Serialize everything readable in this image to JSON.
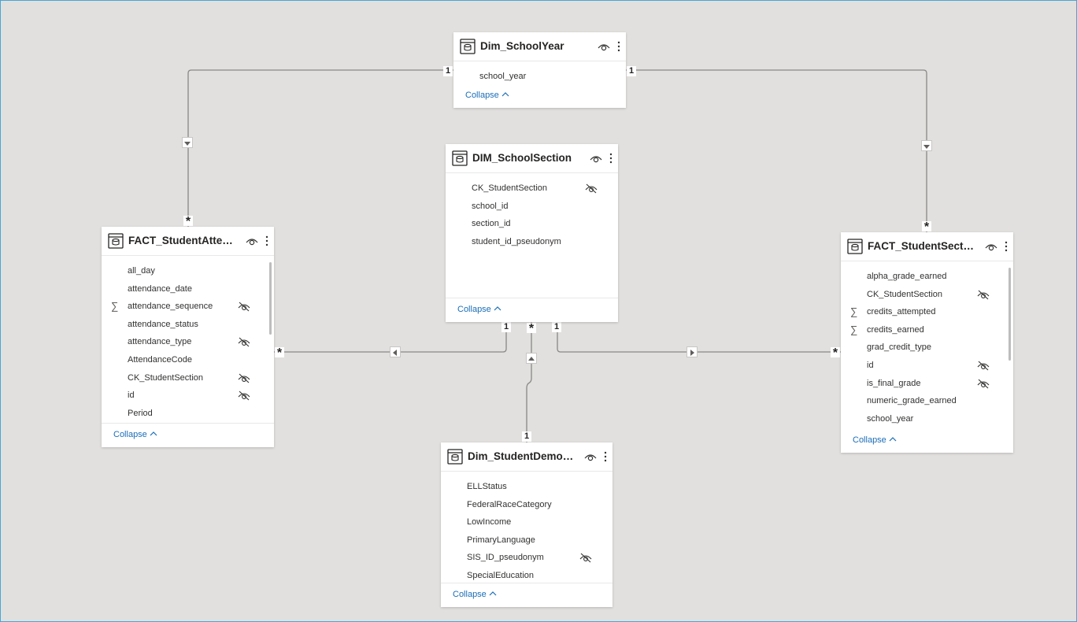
{
  "tables": {
    "school_year": {
      "title": "Dim_SchoolYear",
      "fields": [
        {
          "name": "school_year"
        }
      ],
      "collapse_label": "Collapse"
    },
    "school_section": {
      "title": "DIM_SchoolSection",
      "fields": [
        {
          "name": "CK_StudentSection",
          "hidden": true
        },
        {
          "name": "school_id"
        },
        {
          "name": "section_id"
        },
        {
          "name": "student_id_pseudonym"
        }
      ],
      "collapse_label": "Collapse"
    },
    "attendance": {
      "title": "FACT_StudentAttenda...",
      "fields": [
        {
          "name": "all_day"
        },
        {
          "name": "attendance_date"
        },
        {
          "name": "attendance_sequence",
          "sum": true,
          "hidden": true
        },
        {
          "name": "attendance_status"
        },
        {
          "name": "attendance_type",
          "hidden": true
        },
        {
          "name": "AttendanceCode"
        },
        {
          "name": "CK_StudentSection",
          "hidden": true
        },
        {
          "name": "id",
          "hidden": true
        },
        {
          "name": "Period"
        }
      ],
      "collapse_label": "Collapse"
    },
    "section_grades": {
      "title": "FACT_StudentSection...",
      "fields": [
        {
          "name": "alpha_grade_earned"
        },
        {
          "name": "CK_StudentSection",
          "hidden": true
        },
        {
          "name": "credits_attempted",
          "sum": true
        },
        {
          "name": "credits_earned",
          "sum": true
        },
        {
          "name": "grad_credit_type"
        },
        {
          "name": "id",
          "hidden": true
        },
        {
          "name": "is_final_grade",
          "hidden": true
        },
        {
          "name": "numeric_grade_earned"
        },
        {
          "name": "school_year"
        }
      ],
      "collapse_label": "Collapse"
    },
    "demographics": {
      "title": "Dim_StudentDemogr...",
      "fields": [
        {
          "name": "ELLStatus"
        },
        {
          "name": "FederalRaceCategory"
        },
        {
          "name": "LowIncome"
        },
        {
          "name": "PrimaryLanguage"
        },
        {
          "name": "SIS_ID_pseudonym",
          "hidden": true
        },
        {
          "name": "SpecialEducation"
        }
      ],
      "collapse_label": "Collapse"
    }
  },
  "cardinality": {
    "one": "1",
    "many": "*"
  },
  "icons": {
    "table": "table-icon",
    "visible": "eye-icon",
    "more": "more-options-icon",
    "hidden": "eye-hidden-icon",
    "sum": "sigma-icon",
    "collapse": "chevron-up-icon",
    "filter_direction": "triangle-arrow-icon"
  },
  "colors": {
    "canvas": "#e1e0de",
    "card": "#ffffff",
    "link": "#1a6eb8",
    "line": "#8a8886",
    "frame": "#47a6d8"
  }
}
